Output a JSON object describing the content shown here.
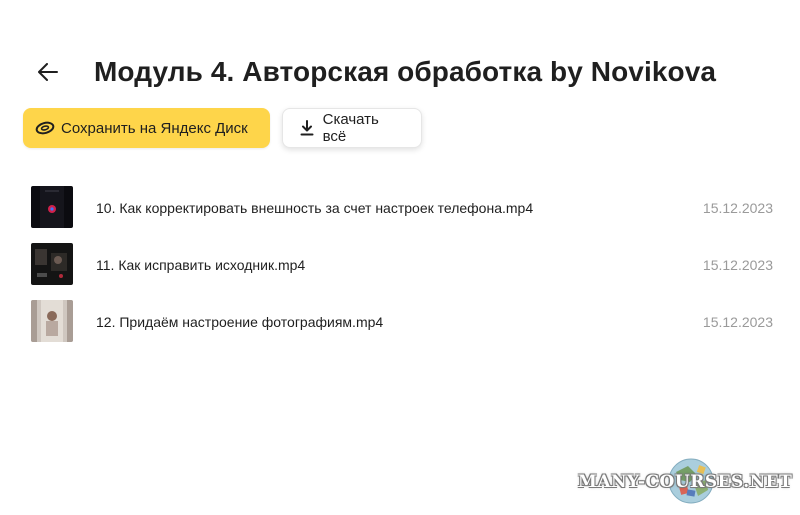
{
  "page": {
    "title": "Модуль 4. Авторская обработка by Novikova",
    "back_icon": "arrow-left-icon"
  },
  "actions": {
    "save_label": "Сохранить на Яндекс Диск",
    "save_icon": "yandex-disk-icon",
    "save_color": "#fed54a",
    "download_label": "Скачать всё",
    "download_icon": "download-icon"
  },
  "files": [
    {
      "name": "10. Как корректировать внешность за счет настроек телефона.mp4",
      "date": "15.12.2023",
      "thumb_icon": "video-thumbnail-icon"
    },
    {
      "name": "11. Как исправить исходник.mp4",
      "date": "15.12.2023",
      "thumb_icon": "video-thumbnail-icon"
    },
    {
      "name": "12. Придаём настроение фотографиям.mp4",
      "date": "15.12.2023",
      "thumb_icon": "video-thumbnail-icon"
    }
  ],
  "watermark": {
    "text": "MANY-COURSES.NET"
  }
}
